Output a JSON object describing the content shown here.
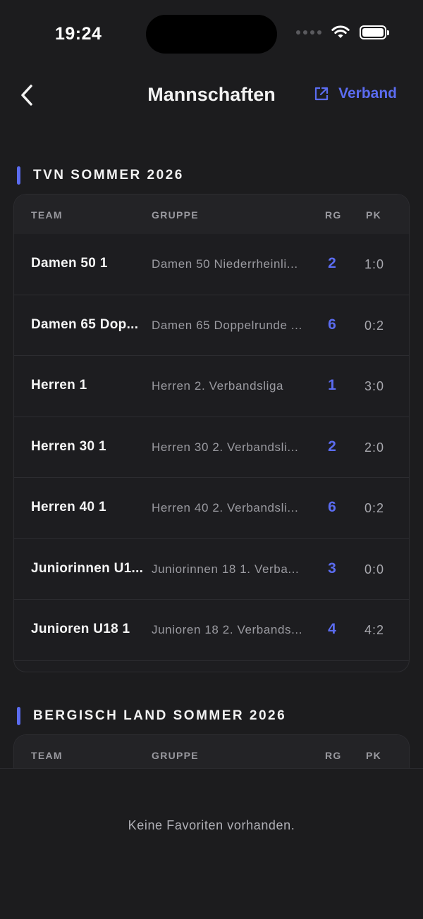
{
  "status_bar": {
    "time": "19:24"
  },
  "nav": {
    "title": "Mannschaften",
    "verband_label": "Verband"
  },
  "columns": {
    "team": "TEAM",
    "group": "GRUPPE",
    "rg": "RG",
    "pk": "PK"
  },
  "sections": [
    {
      "title": "TVN SOMMER 2026",
      "rows": [
        {
          "team": "Damen 50 1",
          "group": "Damen 50 Niederrheinli...",
          "rg": "2",
          "pk": "1:0"
        },
        {
          "team": "Damen 65 Dop...",
          "group": "Damen 65 Doppelrunde ...",
          "rg": "6",
          "pk": "0:2"
        },
        {
          "team": "Herren 1",
          "group": "Herren 2. Verbandsliga",
          "rg": "1",
          "pk": "3:0"
        },
        {
          "team": "Herren 30 1",
          "group": "Herren 30 2. Verbandsli...",
          "rg": "2",
          "pk": "2:0"
        },
        {
          "team": "Herren 40 1",
          "group": "Herren 40 2. Verbandsli...",
          "rg": "6",
          "pk": "0:2"
        },
        {
          "team": "Juniorinnen U1...",
          "group": "Juniorinnen 18 1. Verba...",
          "rg": "3",
          "pk": "0:0"
        },
        {
          "team": "Junioren U18 1",
          "group": "Junioren 18 2. Verbands...",
          "rg": "4",
          "pk": "4:2"
        }
      ]
    },
    {
      "title": "BERGISCH LAND SOMMER 2026",
      "rows": []
    }
  ],
  "empty_message": "Keine Favoriten vorhanden.",
  "colors": {
    "accent": "#5b6cf0",
    "background": "#1c1c1e"
  },
  "icons": {
    "back": "chevron-left-icon",
    "external": "external-link-icon"
  }
}
